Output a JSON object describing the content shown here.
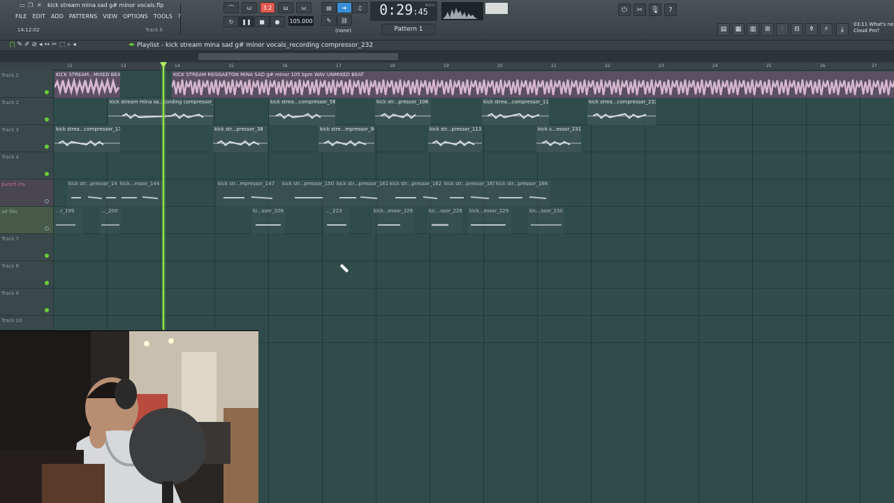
{
  "app": {
    "file_title": "kick stream mina sad g# minor vocals.flp",
    "hint_left": "14:12:02",
    "hint_right": "Track 8",
    "menu": [
      "FILE",
      "EDIT",
      "ADD",
      "PATTERNS",
      "VIEW",
      "OPTIONS",
      "TOOLS",
      "?"
    ]
  },
  "transport": {
    "time_main": "0:29",
    "time_sub": ":45",
    "time_unit": "M:S:CS",
    "tempo": "105.000",
    "pattern": "Pattern 1",
    "snap": "(none)",
    "record_count": "3.2"
  },
  "cloud": {
    "line1": "03:11  What's ne",
    "line2": "Cloud Pro?"
  },
  "playlist": {
    "title": "Playlist - kick stream mina sad g# minor vocals_recording compressor_232",
    "ruler": [
      "12",
      "13",
      "14",
      "15",
      "16",
      "17",
      "18",
      "19",
      "20",
      "21",
      "22",
      "23",
      "24",
      "25",
      "26",
      "27"
    ],
    "tracks": [
      "Track 1",
      "Track 2",
      "Track 3",
      "Track 4",
      "punch ins",
      "ad libs",
      "Track 7",
      "Track 8",
      "Track 9",
      "Track 10"
    ],
    "clips_track1": [
      "KICK STREAM...MIXED BEAT",
      "KICK STREAM REGGAETON MINA SAD g# minor 105 bpm WAV UNMIXED BEAT"
    ],
    "clips_track2": [
      "kick stream mina sa...cording compressor_20",
      "kick strea...compressor_56",
      "kick str...pressor_106",
      "kick strea...compressor_117",
      "kick strea...compressor_232"
    ],
    "clips_track3": [
      "kick strea...compressor_17",
      "kick str...pressor_38",
      "kick stre...mpressor_98",
      "kick str...pressor_113",
      "kick s...essor_231"
    ],
    "clips_track5": [
      "kick str...pressor_14",
      "kick...essor_144",
      "kick str...mpressor_147",
      "kick str...pressor_150",
      "kick str...pressor_161",
      "kick str...pressor_162",
      "kick str...pressor_165",
      "kick str...pressor_166"
    ],
    "clips_track6": [
      "...r_199",
      "..._200",
      "ki...ssor_208",
      "..._223",
      "kick...essor_226",
      "kic...ssor_228",
      "kick...essor_229",
      "kic...ssor_230"
    ]
  }
}
